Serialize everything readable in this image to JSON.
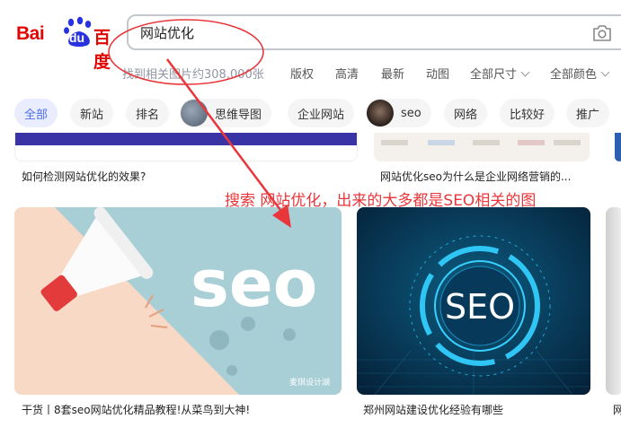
{
  "logo": {
    "part1": "Bai",
    "part2": "du",
    "part3": "百度"
  },
  "search": {
    "query": "网站优化"
  },
  "filters": {
    "result_count": "找到相关图片约308,000张",
    "items": [
      "版权",
      "高清",
      "最新",
      "动图",
      "全部尺寸",
      "全部颜色"
    ]
  },
  "tags": [
    "全部",
    "新站",
    "排名",
    "思维导图",
    "企业网站",
    "seo",
    "网络",
    "比较好",
    "推广"
  ],
  "top_cards": [
    {
      "caption": "如何检测网站优化的效果?"
    },
    {
      "caption": "网站优化seo为什么是企业网络营销的..."
    }
  ],
  "annotation": "搜索 网站优化，出来的大多都是SEO相关的图",
  "cards": [
    {
      "image_text": "seo",
      "watermark": "麦琪设计湖",
      "caption": "干货丨8套seo网站优化精品教程!从菜鸟到大神!"
    },
    {
      "image_text": "SEO",
      "caption": "郑州网站建设优化经验有哪些"
    },
    {
      "caption": "网"
    }
  ],
  "colors": {
    "brand_red": "#e10601",
    "brand_blue": "#2932e1",
    "accent": "#4e6ef2",
    "annotation_red": "#e8363a"
  }
}
